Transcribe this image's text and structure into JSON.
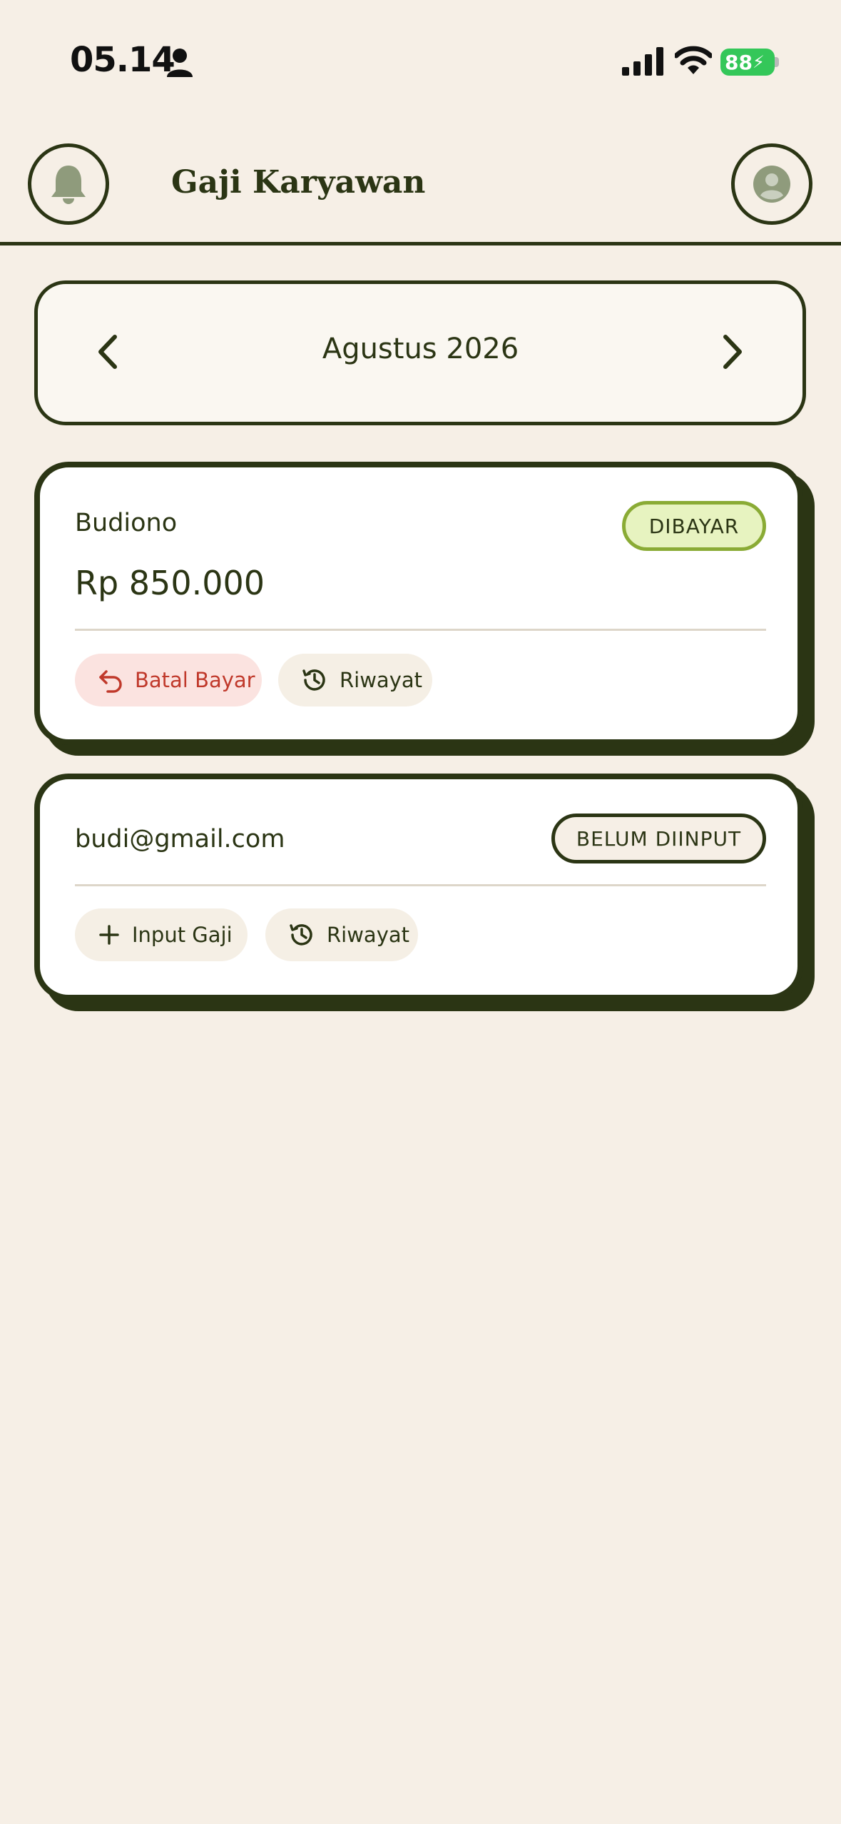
{
  "status_bar": {
    "time": "05.14",
    "battery": "88",
    "icons": [
      "person-icon",
      "signal-icon",
      "wifi-icon",
      "battery-icon"
    ]
  },
  "header": {
    "title": "Gaji Karyawan",
    "left_icon": "bell-icon",
    "right_icon": "avatar-icon"
  },
  "month_selector": {
    "label": "Agustus 2026",
    "prev_icon": "chevron-left-icon",
    "next_icon": "chevron-right-icon"
  },
  "employees": [
    {
      "name": "Budiono",
      "amount": "Rp 850.000",
      "status": "DIBAYAR",
      "actions": [
        {
          "label": "Batal Bayar",
          "icon": "undo-icon"
        },
        {
          "label": "Riwayat",
          "icon": "history-icon"
        }
      ]
    },
    {
      "name": "budi@gmail.com",
      "status": "BELUM DIINPUT",
      "actions": [
        {
          "label": "Input Gaji",
          "icon": "plus-icon"
        },
        {
          "label": "Riwayat",
          "icon": "history-icon"
        }
      ]
    }
  ],
  "colors": {
    "background": "#f6efe6",
    "primary": "#2b3514",
    "paid_badge": "#e7f3c0",
    "danger": "#c0392b",
    "battery": "#34c759"
  }
}
